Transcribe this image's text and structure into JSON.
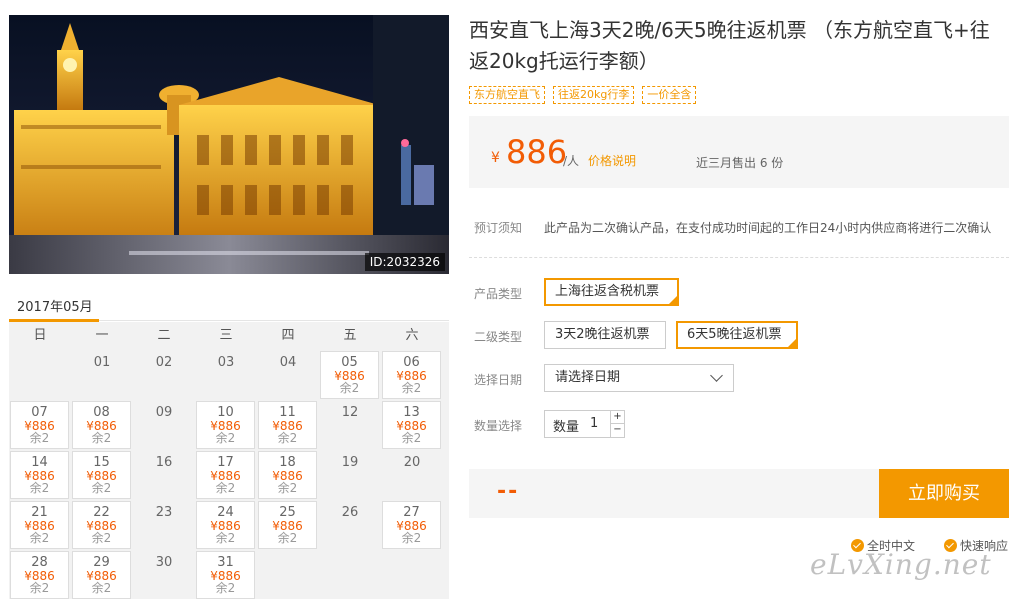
{
  "photo": {
    "id_label": "ID:2032326"
  },
  "calendar": {
    "month": "2017年05月",
    "weekdays": [
      "日",
      "一",
      "二",
      "三",
      "四",
      "五",
      "六"
    ],
    "cells": [
      {
        "d": "",
        "a": false
      },
      {
        "d": "01",
        "a": false
      },
      {
        "d": "02",
        "a": false
      },
      {
        "d": "03",
        "a": false
      },
      {
        "d": "04",
        "a": false
      },
      {
        "d": "05",
        "a": true,
        "p": "¥886",
        "r": "余2"
      },
      {
        "d": "06",
        "a": true,
        "p": "¥886",
        "r": "余2"
      },
      {
        "d": "07",
        "a": true,
        "p": "¥886",
        "r": "余2"
      },
      {
        "d": "08",
        "a": true,
        "p": "¥886",
        "r": "余2"
      },
      {
        "d": "09",
        "a": false
      },
      {
        "d": "10",
        "a": true,
        "p": "¥886",
        "r": "余2"
      },
      {
        "d": "11",
        "a": true,
        "p": "¥886",
        "r": "余2"
      },
      {
        "d": "12",
        "a": false
      },
      {
        "d": "13",
        "a": true,
        "p": "¥886",
        "r": "余2"
      },
      {
        "d": "14",
        "a": true,
        "p": "¥886",
        "r": "余2"
      },
      {
        "d": "15",
        "a": true,
        "p": "¥886",
        "r": "余2"
      },
      {
        "d": "16",
        "a": false
      },
      {
        "d": "17",
        "a": true,
        "p": "¥886",
        "r": "余2"
      },
      {
        "d": "18",
        "a": true,
        "p": "¥886",
        "r": "余2"
      },
      {
        "d": "19",
        "a": false
      },
      {
        "d": "20",
        "a": false
      },
      {
        "d": "21",
        "a": true,
        "p": "¥886",
        "r": "余2"
      },
      {
        "d": "22",
        "a": true,
        "p": "¥886",
        "r": "余2"
      },
      {
        "d": "23",
        "a": false
      },
      {
        "d": "24",
        "a": true,
        "p": "¥886",
        "r": "余2"
      },
      {
        "d": "25",
        "a": true,
        "p": "¥886",
        "r": "余2"
      },
      {
        "d": "26",
        "a": false
      },
      {
        "d": "27",
        "a": true,
        "p": "¥886",
        "r": "余2"
      },
      {
        "d": "28",
        "a": true,
        "p": "¥886",
        "r": "余2"
      },
      {
        "d": "29",
        "a": true,
        "p": "¥886",
        "r": "余2"
      },
      {
        "d": "30",
        "a": false
      },
      {
        "d": "31",
        "a": true,
        "p": "¥886",
        "r": "余2"
      }
    ]
  },
  "product": {
    "title": "西安直飞上海3天2晚/6天5晚往返机票 （东方航空直飞+往返20kg托运行李额）",
    "tags": [
      "东方航空直飞",
      "往返20kg行李",
      "一价全含"
    ]
  },
  "price": {
    "currency": "¥",
    "amount": "886",
    "unit": "/人",
    "explain_link": "价格说明",
    "sold": "近三月售出 6 份"
  },
  "booking": {
    "notice_label": "预订须知",
    "notice_text": "此产品为二次确认产品，在支付成功时间起的工作日24小时内供应商将进行二次确认",
    "type_label": "产品类型",
    "type_option": "上海往返含税机票",
    "subtype_label": "二级类型",
    "subtype_options": [
      "3天2晚往返机票",
      "6天5晚往返机票"
    ],
    "date_label": "选择日期",
    "date_placeholder": "请选择日期",
    "qty_label": "数量选择",
    "qty_inner_label": "数量",
    "qty_value": "1",
    "qty_plus": "+",
    "qty_minus": "−"
  },
  "buy": {
    "total": "--",
    "button": "立即购买"
  },
  "features": [
    "全时中文",
    "快速响应"
  ],
  "watermark": "eLvXing.net",
  "colors": {
    "accent": "#f39800",
    "price": "#f25c05"
  }
}
